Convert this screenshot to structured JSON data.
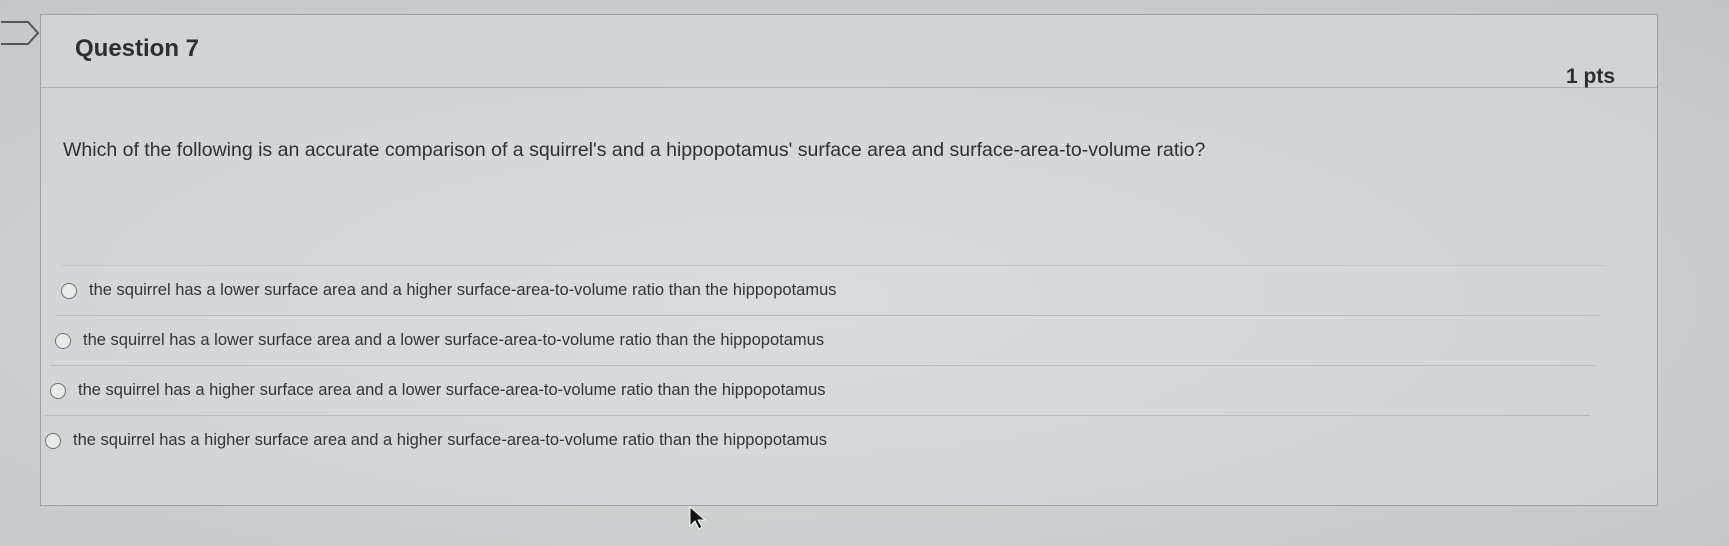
{
  "question": {
    "title": "Question 7",
    "points": "1 pts",
    "prompt": "Which of the following is an accurate comparison of a squirrel's and a hippopotamus' surface area and surface-area-to-volume ratio?"
  },
  "answers": [
    {
      "label": "the squirrel has a lower surface area and a higher surface-area-to-volume ratio than the hippopotamus"
    },
    {
      "label": "the squirrel has a lower surface area and a lower surface-area-to-volume ratio than the hippopotamus"
    },
    {
      "label": "the squirrel has a higher surface area and a lower surface-area-to-volume ratio than the hippopotamus"
    },
    {
      "label": "the squirrel has a higher surface area and a higher surface-area-to-volume ratio than the hippopotamus"
    }
  ],
  "icons": {
    "flag": "flag-icon",
    "radio": "radio-button-icon",
    "cursor": "mouse-cursor-icon"
  },
  "colors": {
    "background": "#c9cccc",
    "text": "#2d3136",
    "border": "#9ea3a5"
  }
}
